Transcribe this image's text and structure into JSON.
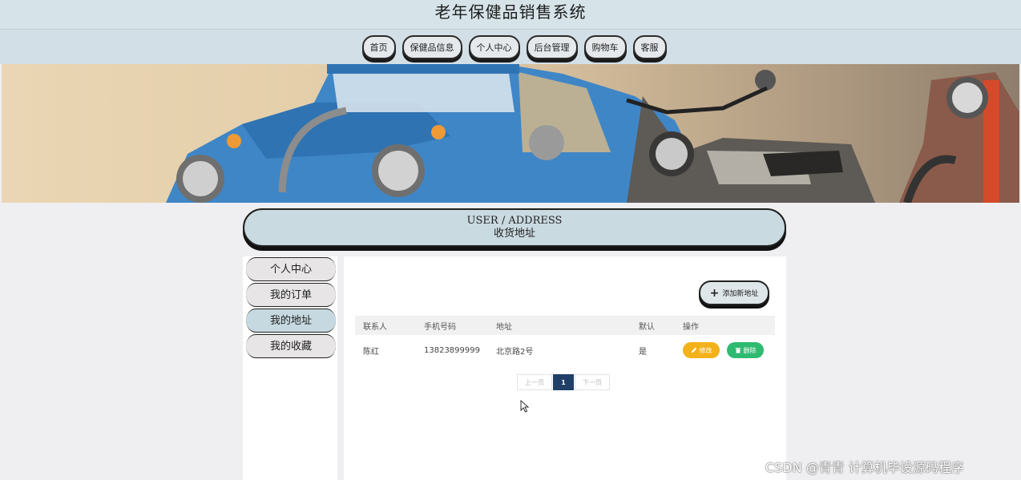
{
  "header": {
    "site_title": "老年保健品销售系统"
  },
  "nav": {
    "items": [
      {
        "label": "首页"
      },
      {
        "label": "保健品信息"
      },
      {
        "label": "个人中心"
      },
      {
        "label": "后台管理"
      },
      {
        "label": "购物车"
      },
      {
        "label": "客服"
      }
    ]
  },
  "banner": {
    "subject": "toy-car-and-motorcycles"
  },
  "section": {
    "title_en": "USER / ADDRESS",
    "title_cn": "收货地址"
  },
  "sidebar": {
    "items": [
      {
        "label": "个人中心",
        "active": false
      },
      {
        "label": "我的订单",
        "active": false
      },
      {
        "label": "我的地址",
        "active": true
      },
      {
        "label": "我的收藏",
        "active": false
      }
    ]
  },
  "main": {
    "add_button": {
      "label": "添加新地址",
      "icon": "plus-icon"
    },
    "table": {
      "headers": [
        "联系人",
        "手机号码",
        "地址",
        "默认",
        "操作"
      ],
      "rows": [
        {
          "contact": "陈红",
          "phone": "13823899999",
          "address": "北京路2号",
          "default": "是"
        }
      ],
      "actions": {
        "edit_label": "修改",
        "edit_icon": "pencil-icon",
        "delete_label": "删除",
        "delete_icon": "trash-icon"
      }
    },
    "pagination": {
      "prev": "上一页",
      "current": "1",
      "next": "下一页"
    }
  },
  "watermark": {
    "text": "CSDN @青青  计算机毕设源码程序"
  },
  "colors": {
    "header_bg": "#d6e3e9",
    "nav_bg": "#d2dfe6",
    "section_bg": "#c9dae1",
    "active_side": "#c6d9e0",
    "edit": "#f3b21a",
    "delete": "#2fba71",
    "page_active": "#1f3f66"
  }
}
